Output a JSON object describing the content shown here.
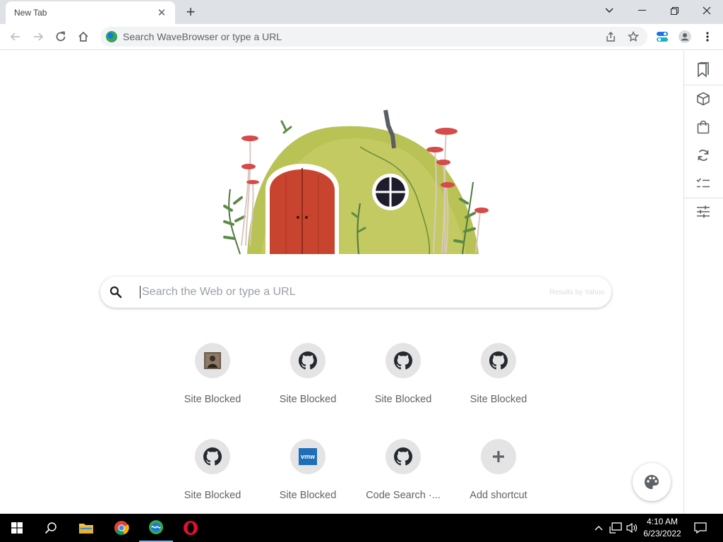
{
  "tab": {
    "title": "New Tab",
    "close_glyph": "✕"
  },
  "newtab": {
    "glyph": "+"
  },
  "omnibox": {
    "placeholder": "Search WaveBrowser or type a URL"
  },
  "search": {
    "placeholder": "Search the Web or type a URL",
    "results_by": "Results by Yahoo"
  },
  "tiles": [
    {
      "label": "Site Blocked",
      "icon": "photo-favicon"
    },
    {
      "label": "Site Blocked",
      "icon": "github-icon"
    },
    {
      "label": "Site Blocked",
      "icon": "github-icon"
    },
    {
      "label": "Site Blocked",
      "icon": "github-icon"
    },
    {
      "label": "Site Blocked",
      "icon": "github-icon"
    },
    {
      "label": "Site Blocked",
      "icon": "vmware-icon",
      "icon_text": "vmw"
    },
    {
      "label": "Code Search ·...",
      "icon": "github-icon"
    },
    {
      "label": "Add shortcut",
      "icon": "plus-icon"
    }
  ],
  "sidebar": {
    "icons": [
      "bookmarks-icon",
      "box-icon",
      "shopping-bag-icon",
      "sync-icon",
      "checklist-icon",
      "sliders-icon"
    ]
  },
  "taskbar": {
    "time": "4:10 AM",
    "date": "6/23/2022"
  },
  "colors": {
    "accent": "#1a73e8",
    "tab_strip": "#dee1e6",
    "taskbar": "#000000",
    "tile_bg": "#e4e4e4"
  }
}
